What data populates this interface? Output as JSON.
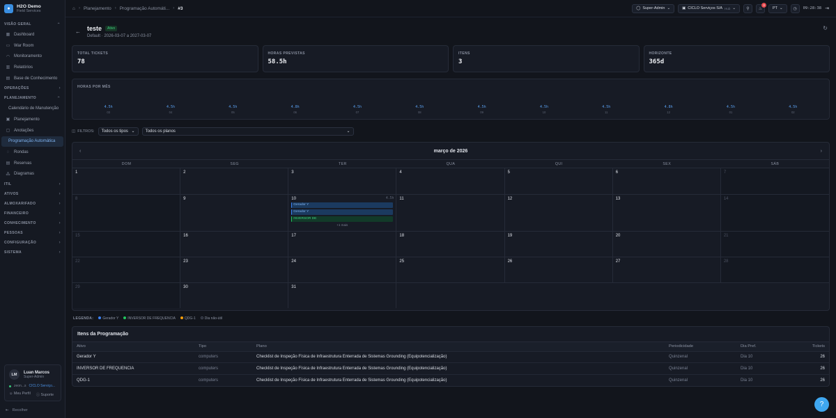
{
  "brand": {
    "name": "H2O Demo",
    "sub": "Field Services"
  },
  "sidebar": {
    "sections": [
      {
        "label": "VISÃO GERAL",
        "items": [
          {
            "label": "Dashboard",
            "icon": "grid-icon"
          },
          {
            "label": "War Room",
            "icon": "monitor-icon"
          },
          {
            "label": "Monitoramento",
            "icon": "pulse-icon"
          },
          {
            "label": "Relatórios",
            "icon": "chart-icon"
          },
          {
            "label": "Base de Conhecimento",
            "icon": "book-icon"
          }
        ]
      },
      {
        "label": "OPERAÇÕES",
        "items": []
      },
      {
        "label": "PLANEJAMENTO",
        "items": [
          {
            "label": "Calendário de Manutenção",
            "icon": ""
          },
          {
            "label": "Planejamento",
            "icon": "calendar-icon"
          },
          {
            "label": "Anotações",
            "icon": "note-icon"
          },
          {
            "label": "Programação Automática",
            "icon": "",
            "active": true
          },
          {
            "label": "Rondas",
            "icon": "route-icon"
          },
          {
            "label": "Reservas",
            "icon": "clipboard-icon"
          },
          {
            "label": "Diagramas",
            "icon": "diagram-icon"
          }
        ]
      },
      {
        "label": "ITIL",
        "items": []
      },
      {
        "label": "ATIVOS",
        "items": []
      },
      {
        "label": "ALMOXARIFADO",
        "items": []
      },
      {
        "label": "FINANCEIRO",
        "items": []
      },
      {
        "label": "CONHECIMENTO",
        "items": []
      },
      {
        "label": "PESSOAS",
        "items": []
      },
      {
        "label": "CONFIGURAÇÃO",
        "items": []
      },
      {
        "label": "SISTEMA",
        "items": []
      }
    ]
  },
  "user": {
    "initials": "LM",
    "name": "Luan Marcos",
    "role": "Super-Admin",
    "org_short": "zeon...s",
    "org_link": "CICLO Serviço...",
    "profile": "Meu Perfil",
    "support": "Suporte",
    "collapse": "Recolher"
  },
  "breadcrumb": [
    "Planejamento",
    "Programação Automáti...",
    "#3"
  ],
  "topbar": {
    "role": "Super-Admin",
    "org": "CICLO Serviços S/A",
    "org_tag": "Hub",
    "notif_count": "3",
    "lang": "PT",
    "time": "09:28:38"
  },
  "page": {
    "title": "teste",
    "status": "Ativo",
    "subtitle": "Default · 2026-03-07 a 2027-03-07"
  },
  "stats": [
    {
      "label": "TOTAL TICKETS",
      "value": "78"
    },
    {
      "label": "HORAS PREVISTAS",
      "value": "58.5h"
    },
    {
      "label": "ITENS",
      "value": "3"
    },
    {
      "label": "HORIZONTE",
      "value": "365d"
    }
  ],
  "hours_title": "HORAS POR MÊS",
  "chart_data": {
    "type": "bar",
    "title": "HORAS POR MÊS",
    "categories": [
      "03",
      "04",
      "05",
      "06",
      "07",
      "08",
      "09",
      "10",
      "11",
      "12",
      "01",
      "02"
    ],
    "labels": [
      "4.5h",
      "4.5h",
      "4.5h",
      "4.8h",
      "4.5h",
      "4.5h",
      "4.5h",
      "4.5h",
      "4.5h",
      "4.8h",
      "4.5h",
      "4.5h"
    ],
    "values": [
      4.5,
      4.5,
      4.5,
      4.8,
      4.5,
      4.5,
      4.5,
      4.5,
      4.5,
      4.8,
      4.5,
      4.5
    ]
  },
  "filters": {
    "label": "FILTROS:",
    "type": "Todos os tipos",
    "plan": "Todos os planos"
  },
  "calendar": {
    "month": "março de 2026",
    "dow": [
      "DOM",
      "SEG",
      "TER",
      "QUA",
      "QUI",
      "SEX",
      "SÁB"
    ],
    "weeks": [
      [
        {
          "d": "1"
        },
        {
          "d": "2"
        },
        {
          "d": "3"
        },
        {
          "d": "4"
        },
        {
          "d": "5"
        },
        {
          "d": "6"
        },
        {
          "d": "7",
          "wk": true
        }
      ],
      [
        {
          "d": "8",
          "wk": true
        },
        {
          "d": "9"
        },
        {
          "d": "10",
          "hrs": "4.5h",
          "events": [
            {
              "t": "Gerador Y",
              "c": "blue"
            },
            {
              "t": "Gerador Y",
              "c": "blue"
            },
            {
              "t": "INVERSOR DE",
              "c": "green"
            }
          ],
          "more": "+1 mais"
        },
        {
          "d": "11"
        },
        {
          "d": "12"
        },
        {
          "d": "13"
        },
        {
          "d": "14",
          "wk": true
        }
      ],
      [
        {
          "d": "15",
          "wk": true
        },
        {
          "d": "16"
        },
        {
          "d": "17"
        },
        {
          "d": "18"
        },
        {
          "d": "19"
        },
        {
          "d": "20"
        },
        {
          "d": "21",
          "wk": true
        }
      ],
      [
        {
          "d": "22",
          "wk": true
        },
        {
          "d": "23"
        },
        {
          "d": "24"
        },
        {
          "d": "25"
        },
        {
          "d": "26"
        },
        {
          "d": "27"
        },
        {
          "d": "28",
          "wk": true
        }
      ],
      [
        {
          "d": "29",
          "wk": true
        },
        {
          "d": "30"
        },
        {
          "d": "31"
        },
        {
          "d": "",
          "empty": true
        },
        {
          "d": "",
          "empty": true
        },
        {
          "d": "",
          "empty": true
        },
        {
          "d": "",
          "empty": true
        }
      ]
    ]
  },
  "legend": {
    "title": "LEGENDA:",
    "items": [
      {
        "label": "Gerador Y",
        "color": "#3b82f6"
      },
      {
        "label": "INVERSOR DE FREQUENCIA",
        "color": "#22c55e"
      },
      {
        "label": "QDG-1",
        "color": "#f59e0b"
      },
      {
        "label": "Dia não-útil",
        "color": "#2a2f3c"
      }
    ]
  },
  "items": {
    "title": "Itens da Programação",
    "columns": [
      "Ativo",
      "Tipo",
      "Plano",
      "Periodicidade",
      "Dia Pref.",
      "Tickets"
    ],
    "rows": [
      [
        "Gerador Y",
        "computers",
        "Checklist de Inspeção Física de Infraestrutura Enterrada de Sistemas Grounding (Equipotencialização)",
        "Quinzenal",
        "Dia 10",
        "26"
      ],
      [
        "INVERSOR DE FREQUENCIA",
        "computers",
        "Checklist de Inspeção Física de Infraestrutura Enterrada de Sistemas Grounding (Equipotencialização)",
        "Quinzenal",
        "Dia 10",
        "26"
      ],
      [
        "QDG-1",
        "computers",
        "Checklist de Inspeção Física de Infraestrutura Enterrada de Sistemas Grounding (Equipotencialização)",
        "Quinzenal",
        "Dia 10",
        "26"
      ]
    ]
  }
}
